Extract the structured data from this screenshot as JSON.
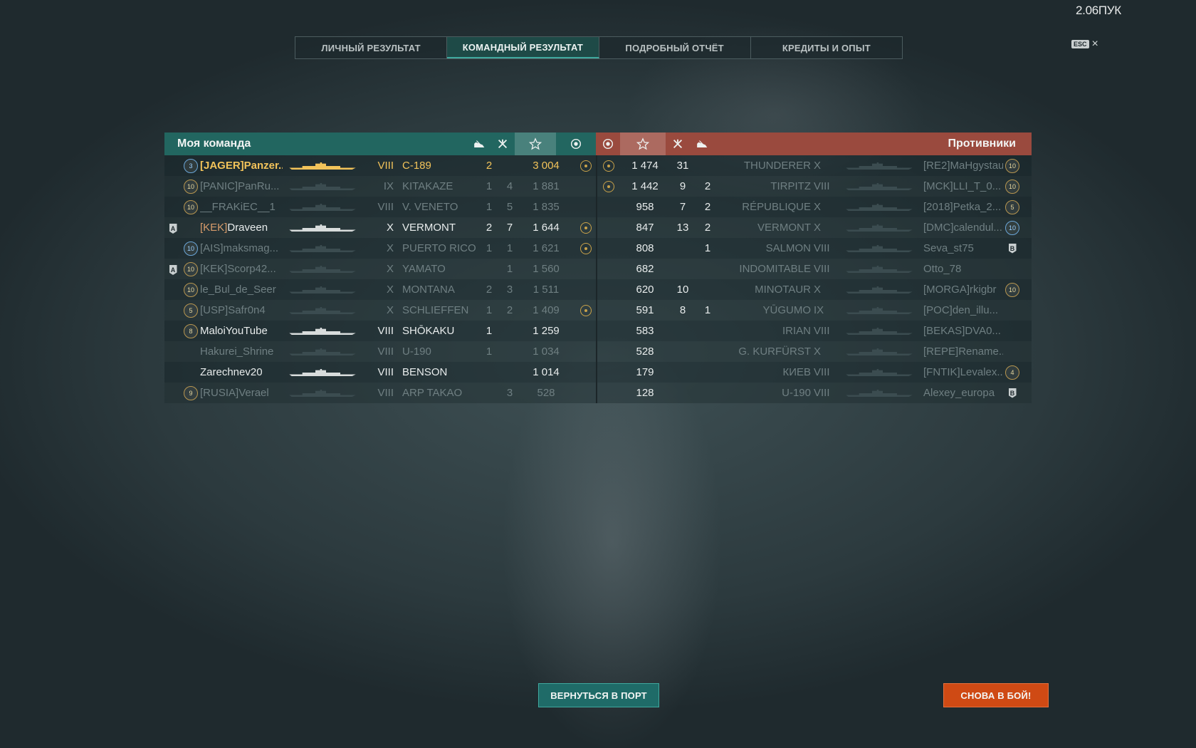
{
  "fps": "2.06ПУК",
  "esc": {
    "key": "ESC",
    "close": "×"
  },
  "tabs": [
    {
      "label": "ЛИЧНЫЙ РЕЗУЛЬТАТ",
      "active": false
    },
    {
      "label": "КОМАНДНЫЙ РЕЗУЛЬТАТ",
      "active": true
    },
    {
      "label": "ПОДРОБНЫЙ ОТЧЁТ",
      "active": false
    },
    {
      "label": "КРЕДИТЫ И ОПЫТ",
      "active": false
    }
  ],
  "my_team": {
    "title": "Моя команда",
    "header_icons": [
      "ship-kill-icon",
      "aircraft-kill-icon",
      "star-icon",
      "medal-icon"
    ],
    "players": [
      {
        "division": "",
        "rank": "3",
        "rank_style": "blue",
        "clan": "[JAGER]",
        "name": "Panzer...",
        "ship_color": "#f2c35a",
        "tier": "VIII",
        "ship": "C-189",
        "ships_killed": "2",
        "planes_killed": "",
        "xp": "3 004",
        "medal": true,
        "style": "you"
      },
      {
        "division": "",
        "rank": "10",
        "rank_style": "gold",
        "clan": "[PANIC]",
        "name": "PanRu...",
        "ship_color": "#3b4c50",
        "tier": "IX",
        "ship": "KITAKAZE",
        "ships_killed": "1",
        "planes_killed": "4",
        "xp": "1 881",
        "medal": false,
        "style": "dim"
      },
      {
        "division": "",
        "rank": "10",
        "rank_style": "gold",
        "clan": "",
        "name": "__FRAKiEC__1",
        "ship_color": "#3b4c50",
        "tier": "VIII",
        "ship": "V. VENETO",
        "ships_killed": "1",
        "planes_killed": "5",
        "xp": "1 835",
        "medal": false,
        "style": "dim"
      },
      {
        "division": "A",
        "rank": "",
        "rank_style": "",
        "clan": "[KEK]",
        "name": "Draveen",
        "ship_color": "#d8dcdc",
        "tier": "X",
        "ship": "VERMONT",
        "ships_killed": "2",
        "planes_killed": "7",
        "xp": "1 644",
        "medal": true,
        "style": "white"
      },
      {
        "division": "",
        "rank": "10",
        "rank_style": "blue",
        "clan": "[AIS]",
        "name": "maksmag...",
        "ship_color": "#3b4c50",
        "tier": "X",
        "ship": "PUERTO RICO",
        "ships_killed": "1",
        "planes_killed": "1",
        "xp": "1 621",
        "medal": true,
        "style": "dim"
      },
      {
        "division": "A",
        "rank": "10",
        "rank_style": "gold",
        "clan": "[KEK]",
        "name": "Scorp42...",
        "ship_color": "#3b4c50",
        "tier": "X",
        "ship": "YAMATO",
        "ships_killed": "",
        "planes_killed": "1",
        "xp": "1 560",
        "medal": false,
        "style": "dim"
      },
      {
        "division": "",
        "rank": "10",
        "rank_style": "gold",
        "clan": "",
        "name": "le_Bul_de_Seer",
        "ship_color": "#3b4c50",
        "tier": "X",
        "ship": "MONTANA",
        "ships_killed": "2",
        "planes_killed": "3",
        "xp": "1 511",
        "medal": false,
        "style": "dim"
      },
      {
        "division": "",
        "rank": "5",
        "rank_style": "gold",
        "clan": "[USP]",
        "name": "Safr0n4",
        "ship_color": "#3b4c50",
        "tier": "X",
        "ship": "SCHLIEFFEN",
        "ships_killed": "1",
        "planes_killed": "2",
        "xp": "1 409",
        "medal": true,
        "style": "dim"
      },
      {
        "division": "",
        "rank": "8",
        "rank_style": "gold",
        "clan": "",
        "name": "MaloiYouTube",
        "ship_color": "#d8dcdc",
        "tier": "VIII",
        "ship": "SHŌKAKU",
        "ships_killed": "1",
        "planes_killed": "",
        "xp": "1 259",
        "medal": false,
        "style": "white"
      },
      {
        "division": "",
        "rank": "",
        "rank_style": "",
        "clan": "",
        "name": "Hakurei_Shrine",
        "ship_color": "#3b4c50",
        "tier": "VIII",
        "ship": "U-190",
        "ships_killed": "1",
        "planes_killed": "",
        "xp": "1 034",
        "medal": false,
        "style": "dim"
      },
      {
        "division": "",
        "rank": "",
        "rank_style": "",
        "clan": "",
        "name": "Zarechnev20",
        "ship_color": "#d8dcdc",
        "tier": "VIII",
        "ship": "BENSON",
        "ships_killed": "",
        "planes_killed": "",
        "xp": "1 014",
        "medal": false,
        "style": "white"
      },
      {
        "division": "",
        "rank": "9",
        "rank_style": "gold",
        "clan": "[RUSIA]",
        "name": "Verael",
        "ship_color": "#3b4c50",
        "tier": "VIII",
        "ship": "ARP TAKAO",
        "ships_killed": "",
        "planes_killed": "3",
        "xp": "528",
        "medal": false,
        "style": "dim"
      }
    ]
  },
  "enemy_team": {
    "title": "Противники",
    "header_icons": [
      "medal-icon",
      "star-icon",
      "aircraft-kill-icon",
      "ship-kill-icon"
    ],
    "players": [
      {
        "medal": true,
        "xp": "1 474",
        "planes_killed": "31",
        "ships_killed": "",
        "ship": "THUNDERER",
        "tier": "X",
        "clan": "[RE2]",
        "name": "MaHgystau",
        "rank": "10",
        "rank_style": "gold",
        "division": ""
      },
      {
        "medal": true,
        "xp": "1 442",
        "planes_killed": "9",
        "ships_killed": "2",
        "ship": "TIRPITZ",
        "tier": "VIII",
        "clan": "[MCK]",
        "name": "LLI_T_0...",
        "rank": "10",
        "rank_style": "gold",
        "division": ""
      },
      {
        "medal": false,
        "xp": "958",
        "planes_killed": "7",
        "ships_killed": "2",
        "ship": "RÉPUBLIQUE",
        "tier": "X",
        "clan": "[2018]",
        "name": "Petka_2...",
        "rank": "5",
        "rank_style": "gold",
        "division": ""
      },
      {
        "medal": false,
        "xp": "847",
        "planes_killed": "13",
        "ships_killed": "2",
        "ship": "VERMONT",
        "tier": "X",
        "clan": "[DMC]",
        "name": "calendul...",
        "rank": "10",
        "rank_style": "blue",
        "division": ""
      },
      {
        "medal": false,
        "xp": "808",
        "planes_killed": "",
        "ships_killed": "1",
        "ship": "SALMON",
        "tier": "VIII",
        "clan": "",
        "name": "Seva_st75",
        "rank": "",
        "rank_style": "",
        "division": "B"
      },
      {
        "medal": false,
        "xp": "682",
        "planes_killed": "",
        "ships_killed": "",
        "ship": "INDOMITABLE",
        "tier": "VIII",
        "clan": "",
        "name": "Otto_78",
        "rank": "",
        "rank_style": "",
        "division": ""
      },
      {
        "medal": false,
        "xp": "620",
        "planes_killed": "10",
        "ships_killed": "",
        "ship": "MINOTAUR",
        "tier": "X",
        "clan": "[MORGA]",
        "name": "rkigbr",
        "rank": "10",
        "rank_style": "gold",
        "division": ""
      },
      {
        "medal": false,
        "xp": "591",
        "planes_killed": "8",
        "ships_killed": "1",
        "ship": "YŪGUMO",
        "tier": "IX",
        "clan": "[POC]",
        "name": "den_illu...",
        "rank": "",
        "rank_style": "",
        "division": ""
      },
      {
        "medal": false,
        "xp": "583",
        "planes_killed": "",
        "ships_killed": "",
        "ship": "IRIAN",
        "tier": "VIII",
        "clan": "[BEKAS]",
        "name": "DVA0...",
        "rank": "",
        "rank_style": "",
        "division": ""
      },
      {
        "medal": false,
        "xp": "528",
        "planes_killed": "",
        "ships_killed": "",
        "ship": "G. KURFÜRST",
        "tier": "X",
        "clan": "[REPE]",
        "name": "Rename...",
        "rank": "",
        "rank_style": "",
        "division": ""
      },
      {
        "medal": false,
        "xp": "179",
        "planes_killed": "",
        "ships_killed": "",
        "ship": "КИЕВ",
        "tier": "VIII",
        "clan": "[FNTIK]",
        "name": "Levalex...",
        "rank": "4",
        "rank_style": "gold",
        "division": ""
      },
      {
        "medal": false,
        "xp": "128",
        "planes_killed": "",
        "ships_killed": "",
        "ship": "U-190",
        "tier": "VIII",
        "clan": "",
        "name": "Alexey_europa",
        "rank": "",
        "rank_style": "",
        "division": "B"
      }
    ]
  },
  "buttons": {
    "return_to_port": "ВЕРНУТЬСЯ В ПОРТ",
    "battle_again": "СНОВА В БОЙ!"
  }
}
